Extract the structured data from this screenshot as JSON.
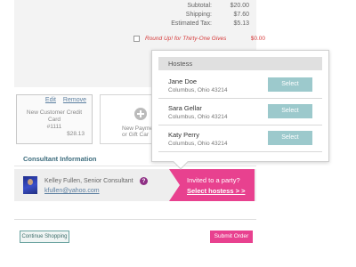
{
  "order_summary": {
    "rows": [
      {
        "label": "Subtotal:",
        "value": "$20.00"
      },
      {
        "label": "Shipping:",
        "value": "$7.60"
      },
      {
        "label": "Estimated Tax:",
        "value": "$5.13"
      }
    ],
    "round_up": {
      "label": "Round Up! for Thirty-One Gives",
      "value": "$0.00",
      "checked": false
    }
  },
  "payment": {
    "card": {
      "edit_label": "Edit",
      "remove_label": "Remove",
      "name": "New Customer Credit Card",
      "number": "#1111",
      "amount": "$28.13"
    },
    "add_method": {
      "line1": "New Payme",
      "line2": "or Gift Car"
    }
  },
  "consultant": {
    "section_title": "Consultant Information",
    "name": "Kelley Fullen, Senior Consultant",
    "email": "kfullen@yahoo.com",
    "help_icon": "question-icon"
  },
  "invite": {
    "title": "Invited to a party?",
    "link": "Select hostess > >"
  },
  "hostess_popup": {
    "header": "Hostess",
    "hostesses": [
      {
        "name": "Jane Doe",
        "location": "Columbus, Ohio 43214",
        "button": "Select"
      },
      {
        "name": "Sara Gellar",
        "location": "Columbus, Ohio 43214",
        "button": "Select"
      },
      {
        "name": "Katy Perry",
        "location": "Columbus, Ohio 43214",
        "button": "Select"
      }
    ]
  },
  "actions": {
    "continue_label": "Continue Shopping",
    "submit_label": "Submit Order"
  },
  "colors": {
    "accent_pink": "#e8418f",
    "select_teal": "#9cc9cc",
    "link_blue": "#5c7fa0",
    "section_teal": "#3e6d7e"
  }
}
